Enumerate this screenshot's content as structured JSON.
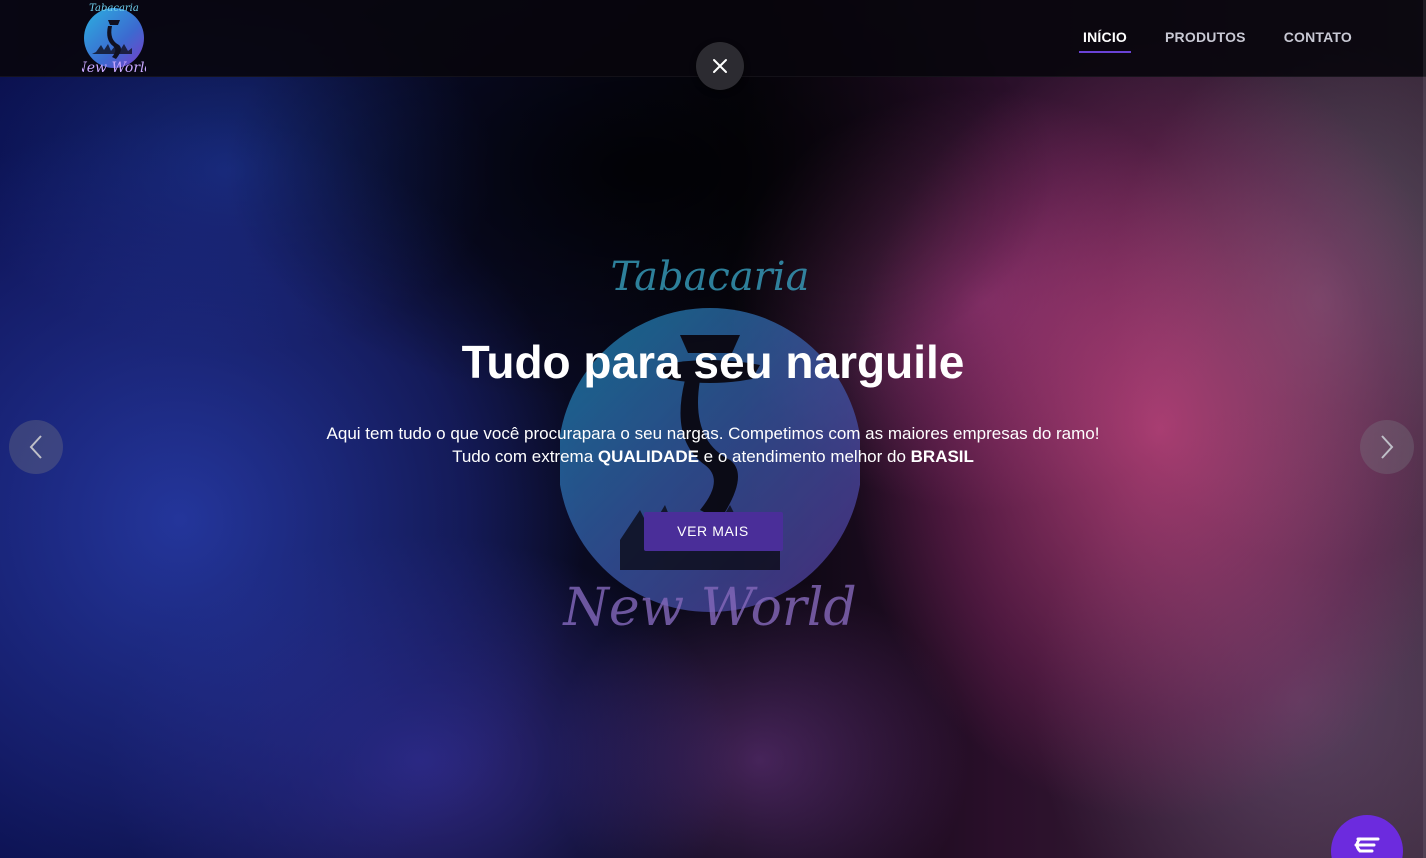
{
  "brand": {
    "logo_top_text": "Tabacaria",
    "logo_bottom_text": "New World"
  },
  "nav": {
    "items": [
      {
        "label": "INÍCIO",
        "active": true
      },
      {
        "label": "PRODUTOS",
        "active": false
      },
      {
        "label": "CONTATO",
        "active": false
      }
    ]
  },
  "hero": {
    "title": "Tudo para seu narguile",
    "line1": "Aqui tem tudo o que você procurapara o seu nargas. Competimos com as maiores empresas do ramo!",
    "line2_pre": "Tudo com extrema ",
    "line2_bold1": "QUALIDADE",
    "line2_mid": " e o atendimento melhor do ",
    "line2_bold2": "BRASIL",
    "cta_label": "VER MAIS"
  },
  "icons": {
    "close": "close-icon",
    "prev": "chevron-left-icon",
    "next": "chevron-right-icon",
    "chat": "chat-icon"
  },
  "colors": {
    "accent": "#6a42d6",
    "cta": "#4a2e99",
    "chat": "#6c2bde"
  }
}
